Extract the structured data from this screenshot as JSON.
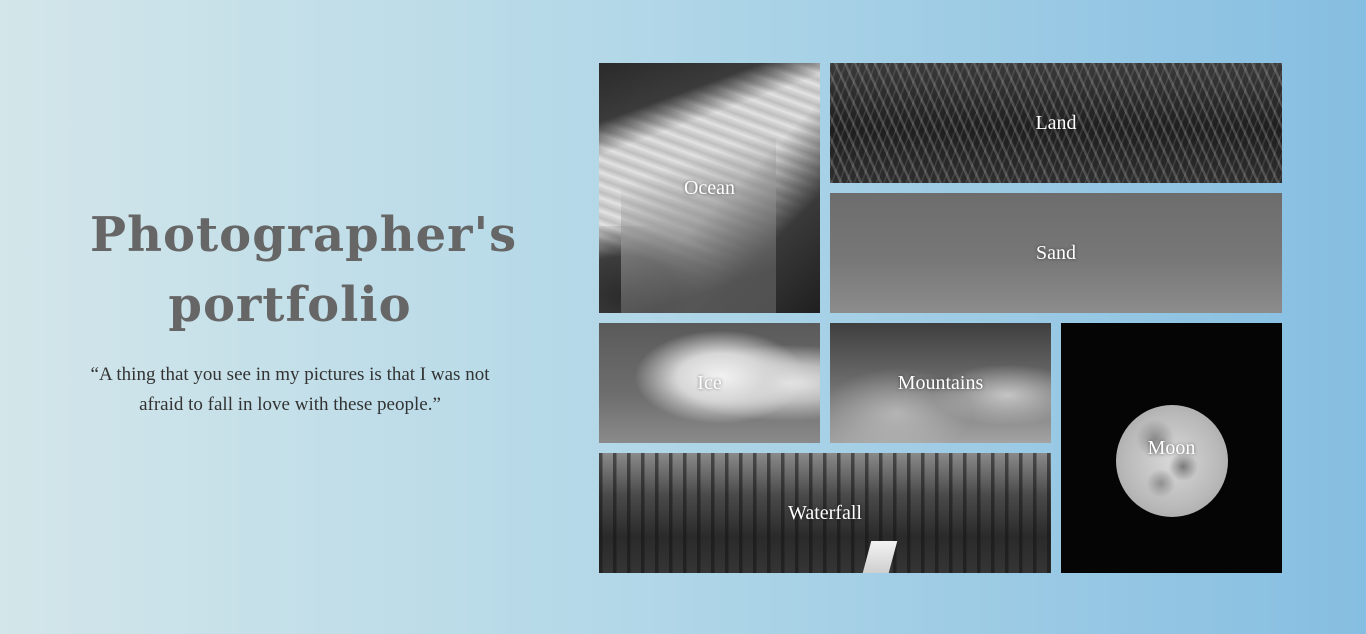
{
  "intro": {
    "title_line1": "Photographer's",
    "title_line2": "portfolio",
    "quote": "“A thing that you see in my pictures is that I was not afraid to fall in love with these people.”"
  },
  "gallery": {
    "tiles": [
      {
        "label": "Ocean"
      },
      {
        "label": "Land"
      },
      {
        "label": "Sand"
      },
      {
        "label": "Ice"
      },
      {
        "label": "Mountains"
      },
      {
        "label": "Moon"
      },
      {
        "label": "Waterfall"
      }
    ]
  },
  "colors": {
    "background_left": "#d3e6ea",
    "background_right": "#86bee1",
    "title": "#666666",
    "quote": "#333333",
    "tile_label": "#ffffff"
  }
}
